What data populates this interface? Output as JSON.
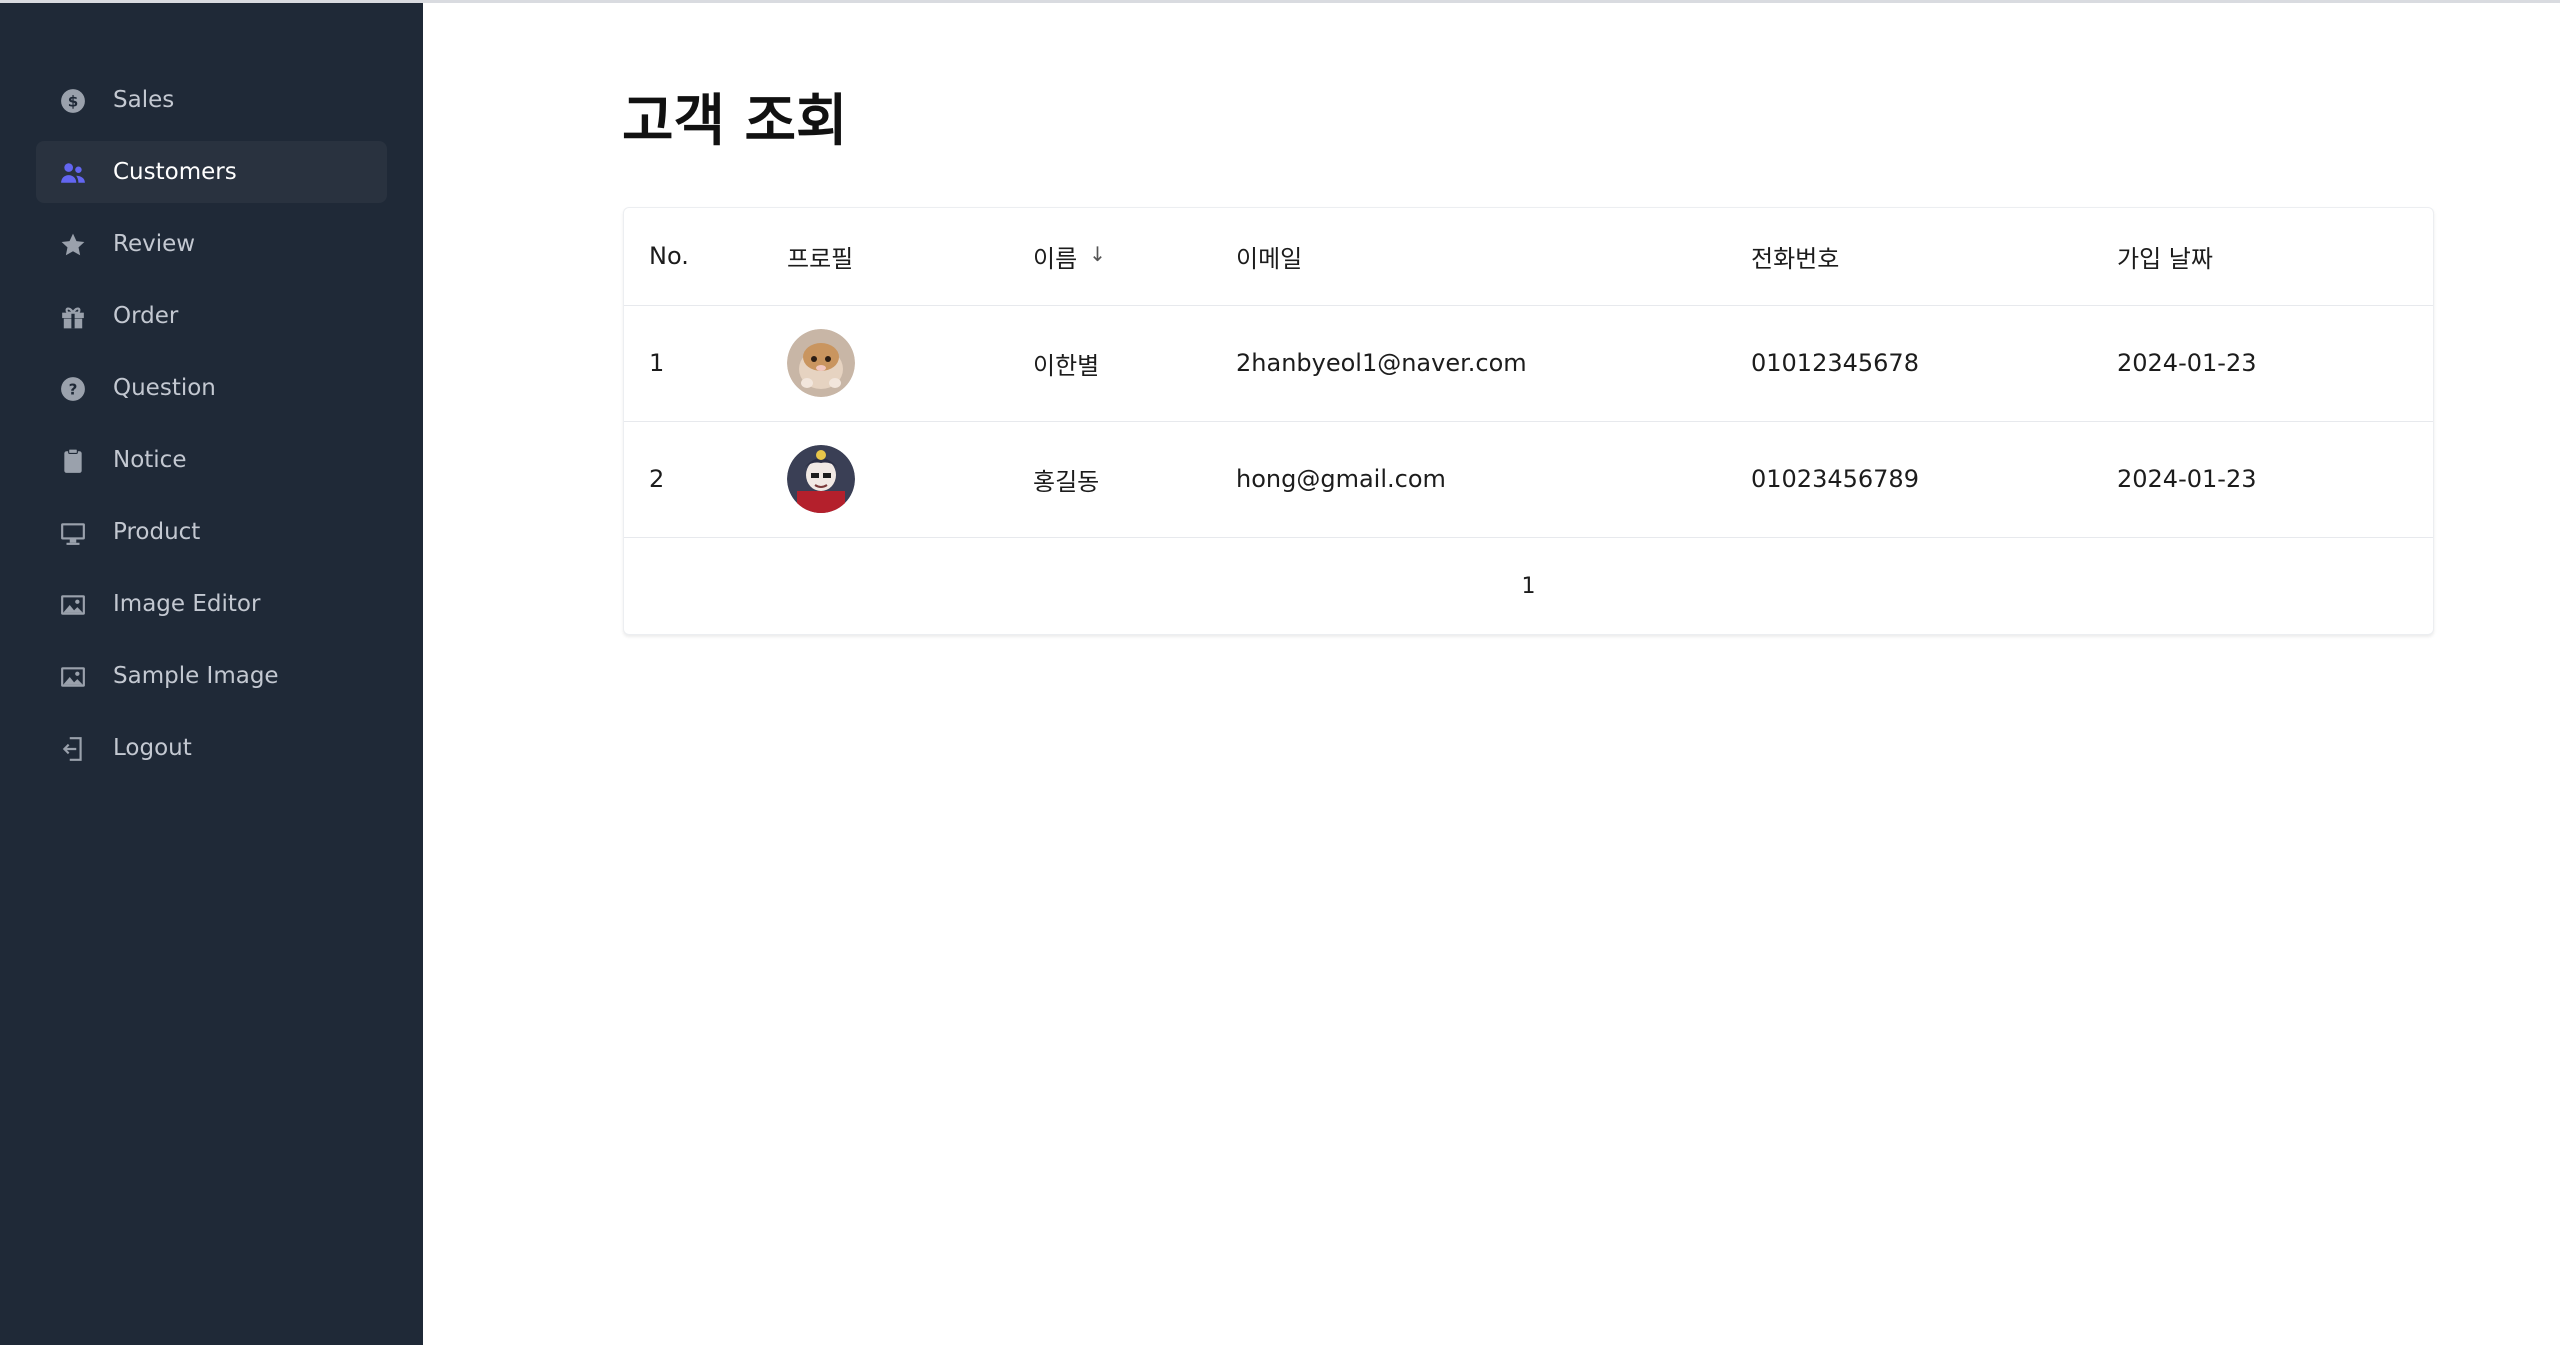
{
  "sidebar": {
    "items": [
      {
        "label": "Sales",
        "icon": "dollar-circle-icon"
      },
      {
        "label": "Customers",
        "icon": "users-icon",
        "active": true
      },
      {
        "label": "Review",
        "icon": "star-icon"
      },
      {
        "label": "Order",
        "icon": "gift-icon"
      },
      {
        "label": "Question",
        "icon": "question-circle-icon"
      },
      {
        "label": "Notice",
        "icon": "clipboard-icon"
      },
      {
        "label": "Product",
        "icon": "monitor-icon"
      },
      {
        "label": "Image Editor",
        "icon": "image-icon"
      },
      {
        "label": "Sample Image",
        "icon": "image-icon"
      },
      {
        "label": "Logout",
        "icon": "logout-icon"
      }
    ]
  },
  "main": {
    "title": "고객 조회",
    "table": {
      "headers": {
        "no": "No.",
        "profile": "프로필",
        "name": "이름",
        "email": "이메일",
        "phone": "전화번호",
        "joined": "가입 날짜"
      },
      "sort_indicator": "↓",
      "rows": [
        {
          "no": "1",
          "name": "이한별",
          "email": "2hanbyeol1@naver.com",
          "phone": "01012345678",
          "joined": "2024-01-23",
          "avatar": "avatar-photo-hamster"
        },
        {
          "no": "2",
          "name": "홍길동",
          "email": "hong@gmail.com",
          "phone": "01023456789",
          "joined": "2024-01-23",
          "avatar": "avatar-photo-character"
        }
      ]
    },
    "pagination": {
      "current": "1"
    }
  },
  "colors": {
    "sidebar_bg": "#1f2937",
    "sidebar_active_bg": "#29323f",
    "accent": "#6366f1",
    "icon_gray": "#9aa1ac"
  }
}
